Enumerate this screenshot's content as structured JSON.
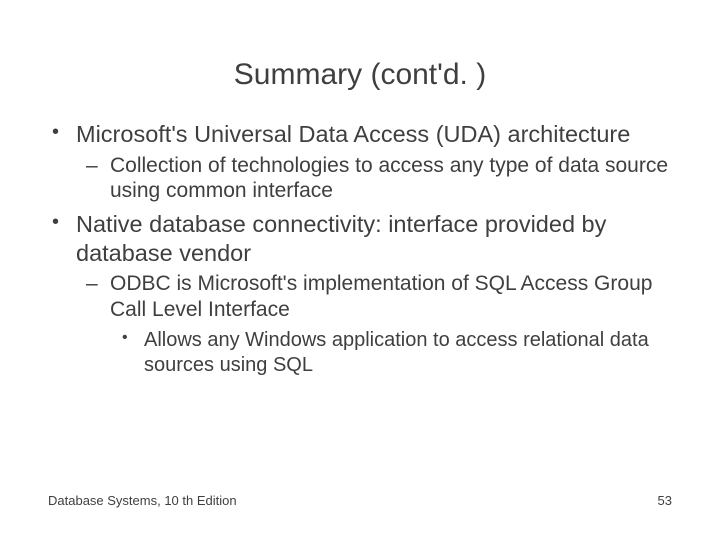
{
  "title": "Summary (cont'd. )",
  "bullets": {
    "b1": "Microsoft's Universal Data Access (UDA) architecture",
    "b1_1": "Collection of technologies to access any type of data source using common interface",
    "b2": "Native database connectivity: interface provided by database vendor",
    "b2_1": "ODBC is Microsoft's implementation of SQL Access Group Call Level Interface",
    "b2_1_1": "Allows any Windows application to access relational data sources using SQL"
  },
  "footer": {
    "left": "Database Systems, 10 th Edition",
    "right": "53"
  }
}
